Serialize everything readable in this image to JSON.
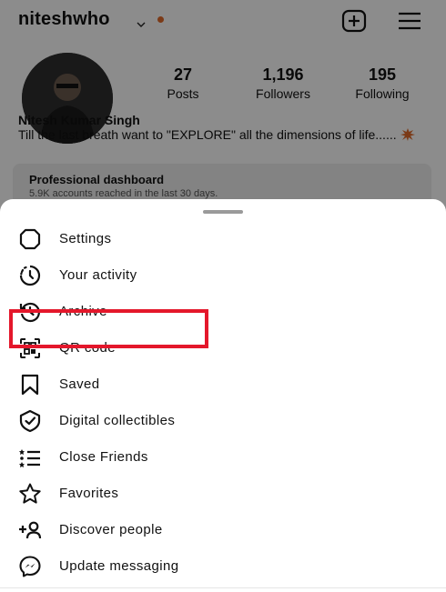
{
  "profile": {
    "username": "niteshwho",
    "accent_color": "#e06a2a",
    "stats": [
      {
        "value": "27",
        "label": "Posts"
      },
      {
        "value": "1,196",
        "label": "Followers"
      },
      {
        "value": "195",
        "label": "Following"
      }
    ],
    "full_name": "Nitesh Kumar Singh",
    "bio": "Till the last breath want to \"EXPLORE\" all the dimensions of life......",
    "dashboard": {
      "title": "Professional dashboard",
      "subtitle": "5.9K accounts reached in the last 30 days."
    }
  },
  "menu": {
    "items": [
      {
        "label": "Settings",
        "icon": "settings-icon"
      },
      {
        "label": "Your activity",
        "icon": "activity-icon"
      },
      {
        "label": "Archive",
        "icon": "archive-icon"
      },
      {
        "label": "QR code",
        "icon": "qr-code-icon"
      },
      {
        "label": "Saved",
        "icon": "bookmark-icon"
      },
      {
        "label": "Digital collectibles",
        "icon": "shield-check-icon"
      },
      {
        "label": "Close Friends",
        "icon": "close-friends-list-icon"
      },
      {
        "label": "Favorites",
        "icon": "star-icon"
      },
      {
        "label": "Discover people",
        "icon": "add-person-icon"
      },
      {
        "label": "Update messaging",
        "icon": "messenger-icon"
      }
    ],
    "highlighted_item": "Discover people",
    "highlight_color": "#e4172b"
  }
}
